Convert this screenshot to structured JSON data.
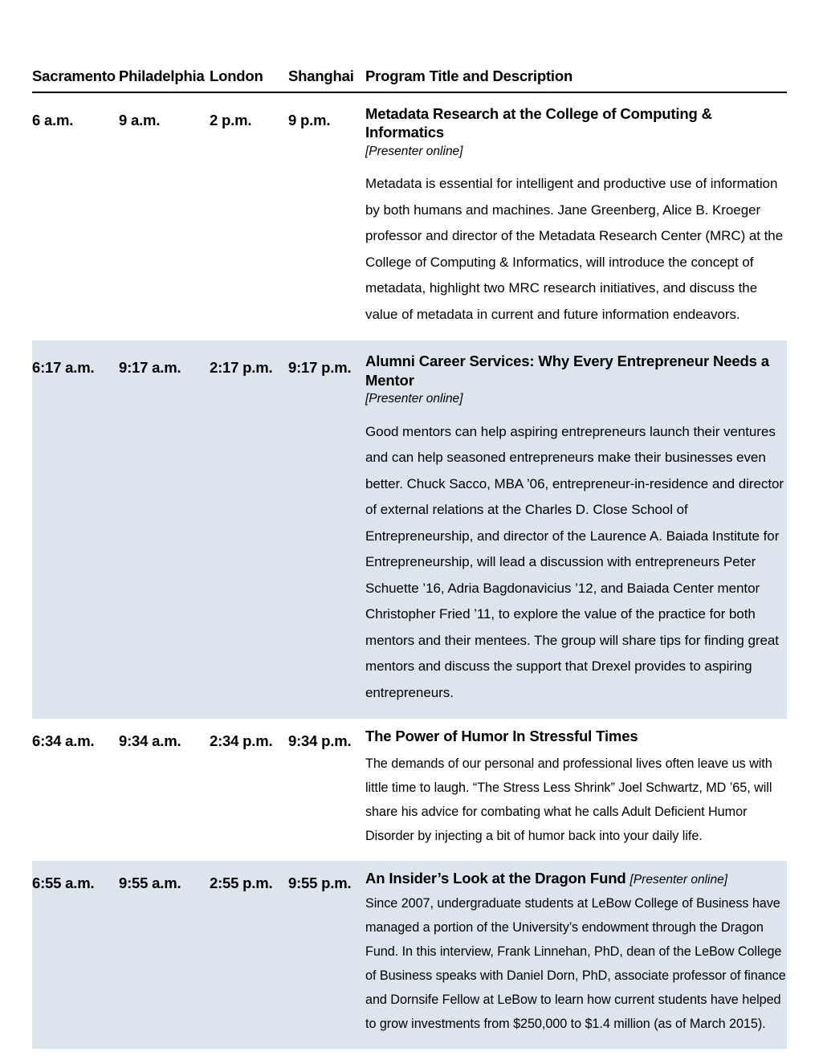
{
  "table": {
    "columns": [
      {
        "key": "sacramento",
        "label": "Sacramento"
      },
      {
        "key": "philadelphia",
        "label": "Philadelphia"
      },
      {
        "key": "london",
        "label": "London"
      },
      {
        "key": "shanghai",
        "label": "Shanghai"
      },
      {
        "key": "program",
        "label": "Program Title and Description"
      }
    ],
    "shade_color": "#dce5ee",
    "rule_color": "#000000",
    "rows": [
      {
        "shaded": false,
        "sacramento": "6 a.m.",
        "philadelphia": "9 a.m.",
        "london": "2 p.m.",
        "shanghai": "9 p.m.",
        "title": "Metadata Research at the College of Computing & Informatics",
        "presenter_note": "[Presenter online]",
        "presenter_inline": false,
        "description": "Metadata is essential for intelligent and productive use of information by both humans and machines. Jane Greenberg, Alice B. Kroeger professor and director of the Metadata Research Center (MRC) at the College of Computing & Informatics, will introduce the concept of metadata, highlight two MRC research initiatives, and discuss the value of metadata in current and future information endeavors."
      },
      {
        "shaded": true,
        "sacramento": "6:17 a.m.",
        "philadelphia": "9:17 a.m.",
        "london": "2:17 p.m.",
        "shanghai": "9:17 p.m.",
        "title": "Alumni Career Services: Why Every Entrepreneur Needs a Mentor",
        "presenter_note": "[Presenter online]",
        "presenter_inline": false,
        "description": "Good mentors can help aspiring entrepreneurs launch their ventures and can help seasoned entrepreneurs make their businesses even better. Chuck Sacco, MBA ’06, entrepreneur-in-residence and director of external relations at the Charles D. Close School of Entrepreneurship, and director of the  Laurence A. Baiada Institute for Entrepreneurship, will lead a discussion with entrepreneurs Peter Schuette ’16, Adria Bagdonavicius ’12, and Baiada Center mentor Christopher Fried ’11, to explore the value of the practice for both mentors and their mentees.  The group will share tips for finding great mentors and discuss the support that Drexel provides to aspiring entrepreneurs."
      },
      {
        "shaded": false,
        "sacramento": "6:34 a.m.",
        "philadelphia": "9:34 a.m.",
        "london": "2:34 p.m.",
        "shanghai": "9:34 p.m.",
        "title": "The Power of Humor In Stressful Times",
        "presenter_note": "",
        "presenter_inline": false,
        "description": "The demands of our personal and professional lives often leave us with little time to laugh. “The Stress Less Shrink” Joel Schwartz, MD ’65, will share his advice for combating what he calls Adult Deficient Humor Disorder by injecting a bit of humor back into your daily life."
      },
      {
        "shaded": true,
        "sacramento": "6:55 a.m.",
        "philadelphia": "9:55 a.m.",
        "london": "2:55 p.m.",
        "shanghai": "9:55 p.m.",
        "title": "An Insider’s Look at the Dragon Fund",
        "presenter_note": "[Presenter online]",
        "presenter_inline": true,
        "description": "Since 2007, undergraduate students at LeBow College of Business have managed a portion of the University’s endowment through the Dragon Fund. In this interview, Frank Linnehan, PhD, dean of the LeBow College of Business speaks with Daniel Dorn, PhD, associate professor of finance and Dornsife Fellow at LeBow to learn how current students have helped to grow investments from $250,000 to $1.4 million (as of March 2015)."
      }
    ]
  }
}
